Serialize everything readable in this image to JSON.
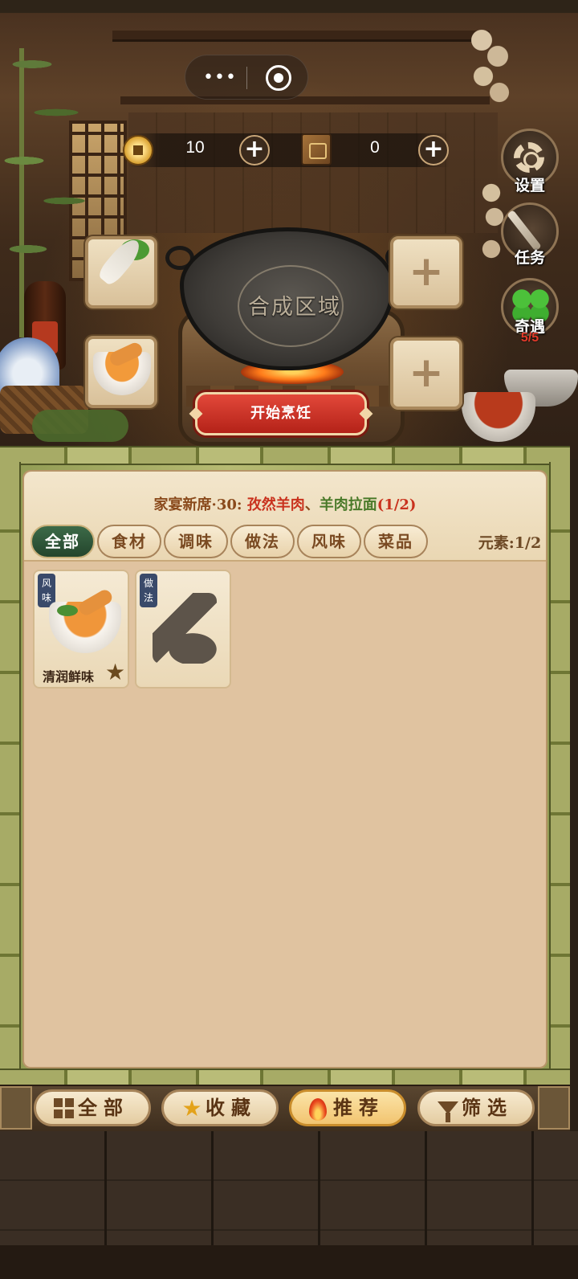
{
  "currency": {
    "coins": "10",
    "books": "0",
    "coin_icon": "copper-coin-icon",
    "book_icon": "recipe-book-icon"
  },
  "side_menu": {
    "settings_label": "设置",
    "tasks_label": "任务",
    "encounter_label": "奇遇",
    "encounter_count": "5/5"
  },
  "wok": {
    "label": "合成区域"
  },
  "slots": {
    "left_top": "radish",
    "left_bottom": "chicken-soup",
    "right_top": "+",
    "right_bottom": "+"
  },
  "cook_button": "开始烹饪",
  "quest": {
    "prefix": "家宴新席·30:",
    "dish1": "孜然羊肉",
    "separator": "、",
    "dish2": "羊肉拉面",
    "progress": "(1/2)"
  },
  "tabs": [
    "全部",
    "食材",
    "调味",
    "做法",
    "风味",
    "菜品"
  ],
  "active_tab": "全部",
  "element_count": "元素:1/2",
  "cards": [
    {
      "badge": "风味",
      "name": "清润鲜味",
      "icon": "chicken-soup-icon",
      "favorited": true
    },
    {
      "badge": "做法",
      "name": "",
      "icon": "locked-silhouette-icon",
      "favorited": false
    }
  ],
  "bottom_nav": [
    {
      "label": "全部",
      "icon": "grid-icon"
    },
    {
      "label": "收藏",
      "icon": "star-icon"
    },
    {
      "label": "推荐",
      "icon": "fire-icon",
      "active": true
    },
    {
      "label": "筛选",
      "icon": "funnel-icon"
    }
  ],
  "colors": {
    "accent_red": "#c9321e",
    "accent_green": "#4a7a2a",
    "active_tab": "#24452c",
    "panel_bg": "#e0c3a0"
  }
}
